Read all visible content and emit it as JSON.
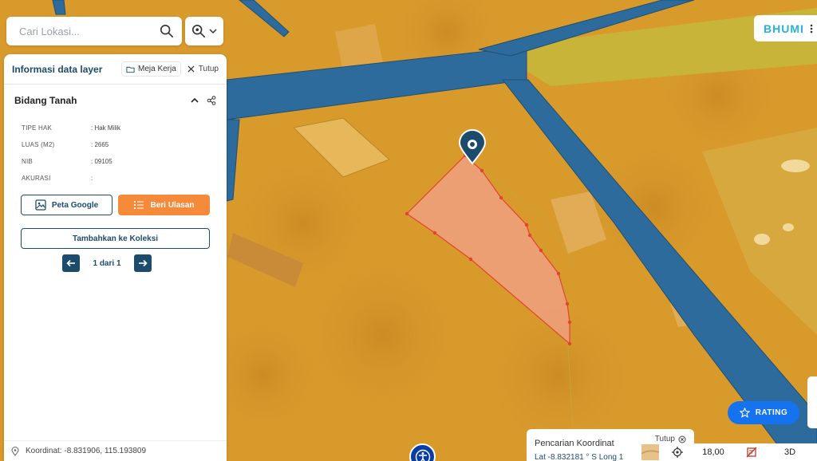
{
  "search": {
    "placeholder": "Cari Lokasi..."
  },
  "panel": {
    "title": "Informasi data layer",
    "workspace_label": "Meja Kerja",
    "close_label": "Tutup",
    "section_title": "Bidang Tanah",
    "attributes": [
      {
        "key": "TIPE HAK",
        "value": ": Hak Milik"
      },
      {
        "key": "LUAS (M2)",
        "value": ": 2665"
      },
      {
        "key": "NIB",
        "value": ": 09105"
      },
      {
        "key": "AKURASI",
        "value": ":"
      }
    ],
    "google_map_label": "Peta Google",
    "review_label": "Beri Ulasan",
    "add_collection_label": "Tambahkan ke Koleksi",
    "pager_text": "1 dari 1",
    "coordinate_text": "Koordinat: -8.831906, 115.193809"
  },
  "logo": {
    "text": "BHUMI"
  },
  "rating": {
    "label": "RATING"
  },
  "coord_search": {
    "title": "Pencarian Koordinat",
    "close_label": "Tutup",
    "lat_text": "Lat -8.832181 ° S  Long 1"
  },
  "bottom_bar": {
    "zoom": "18,00",
    "mode_3d": "3D"
  },
  "colors": {
    "primary": "#1c4b6b",
    "orange": "#f58b3a",
    "rating_blue": "#1673f0",
    "parcel_fill": "#f2a08a",
    "parcel_stroke": "#e0452f",
    "road": "#2d6b9c",
    "map_base": "#d99a2c"
  }
}
